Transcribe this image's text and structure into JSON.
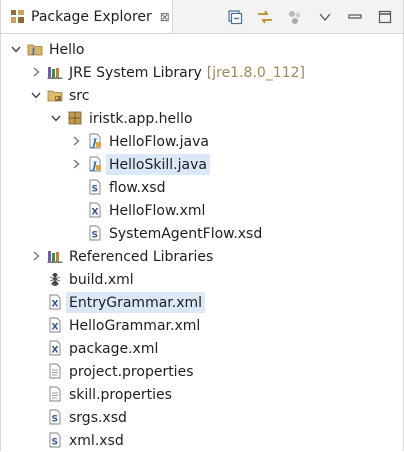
{
  "view": {
    "tab_label": "Package Explorer",
    "tab_close_glyph": "⊠",
    "tool_icons": [
      "collapse-all-icon",
      "link-with-editor-icon",
      "focus-icon",
      "view-menu-chevron-icon",
      "minimize-icon",
      "maximize-icon"
    ]
  },
  "tree": [
    {
      "label": "Hello",
      "icon": "project-icon",
      "expanded": true,
      "depth": 0
    },
    {
      "label": "JRE System Library",
      "decoration": "[jre1.8.0_112]",
      "icon": "library-icon",
      "expanded": false,
      "depth": 1
    },
    {
      "label": "src",
      "icon": "source-folder-icon",
      "expanded": true,
      "depth": 1
    },
    {
      "label": "iristk.app.hello",
      "icon": "package-icon",
      "expanded": true,
      "depth": 2
    },
    {
      "label": "HelloFlow.java",
      "icon": "java-file-icon",
      "expanded": false,
      "depth": 3
    },
    {
      "label": "HelloSkill.java",
      "icon": "java-file-icon",
      "expanded": false,
      "depth": 3,
      "selected": true
    },
    {
      "label": "flow.xsd",
      "icon": "xsd-file-icon",
      "depth": 3
    },
    {
      "label": "HelloFlow.xml",
      "icon": "xml-file-icon",
      "depth": 3
    },
    {
      "label": "SystemAgentFlow.xsd",
      "icon": "xsd-file-icon",
      "depth": 3
    },
    {
      "label": "Referenced Libraries",
      "icon": "library-icon",
      "expanded": false,
      "depth": 1
    },
    {
      "label": "build.xml",
      "icon": "ant-file-icon",
      "depth": 1
    },
    {
      "label": "EntryGrammar.xml",
      "icon": "xml-file-icon",
      "depth": 1,
      "selected": true
    },
    {
      "label": "HelloGrammar.xml",
      "icon": "xml-file-icon",
      "depth": 1
    },
    {
      "label": "package.xml",
      "icon": "xml-file-icon",
      "depth": 1
    },
    {
      "label": "project.properties",
      "icon": "text-file-icon",
      "depth": 1
    },
    {
      "label": "skill.properties",
      "icon": "text-file-icon",
      "depth": 1
    },
    {
      "label": "srgs.xsd",
      "icon": "xsd-file-icon",
      "depth": 1
    },
    {
      "label": "xml.xsd",
      "icon": "xsd-file-icon",
      "depth": 1
    }
  ],
  "colors": {
    "selection": "#dbe8f7",
    "decoration": "#9a8a55",
    "accent": "#2f6fb6"
  }
}
